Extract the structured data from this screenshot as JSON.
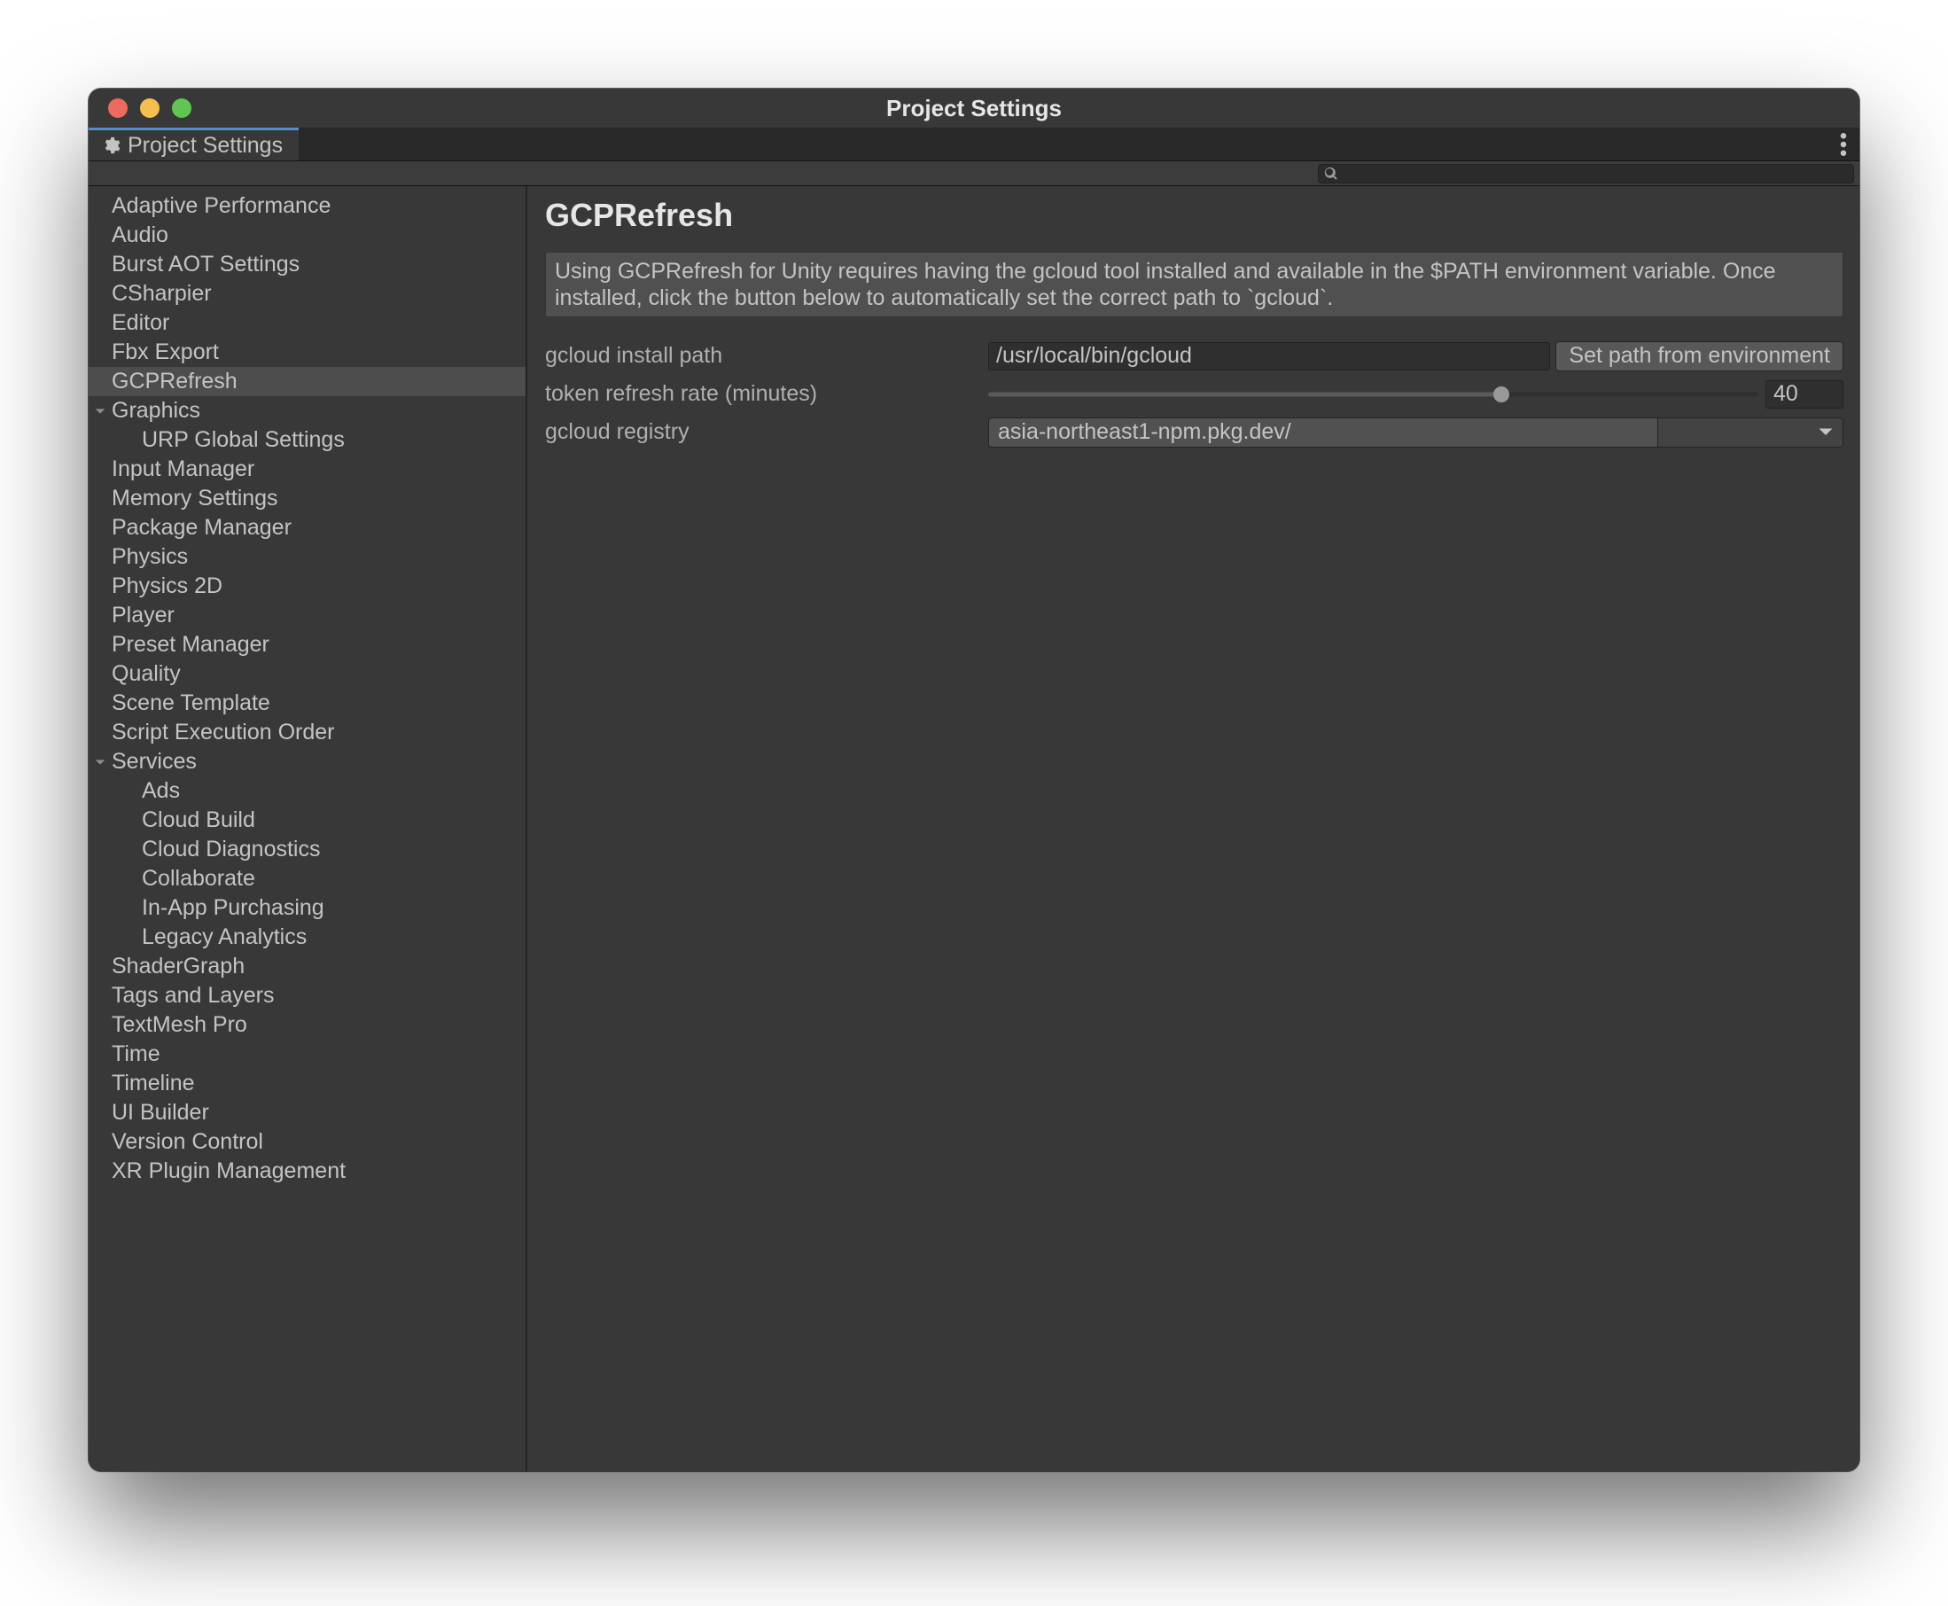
{
  "window": {
    "title": "Project Settings"
  },
  "tab": {
    "label": "Project Settings"
  },
  "search": {
    "value": ""
  },
  "sidebar": {
    "items": [
      {
        "label": "Adaptive Performance",
        "depth": 1
      },
      {
        "label": "Audio",
        "depth": 1
      },
      {
        "label": "Burst AOT Settings",
        "depth": 1
      },
      {
        "label": "CSharpier",
        "depth": 1
      },
      {
        "label": "Editor",
        "depth": 1
      },
      {
        "label": "Fbx Export",
        "depth": 1
      },
      {
        "label": "GCPRefresh",
        "depth": 1,
        "selected": true
      },
      {
        "label": "Graphics",
        "depth": 1,
        "expandable": true,
        "expanded": true
      },
      {
        "label": "URP Global Settings",
        "depth": 2
      },
      {
        "label": "Input Manager",
        "depth": 1
      },
      {
        "label": "Memory Settings",
        "depth": 1
      },
      {
        "label": "Package Manager",
        "depth": 1
      },
      {
        "label": "Physics",
        "depth": 1
      },
      {
        "label": "Physics 2D",
        "depth": 1
      },
      {
        "label": "Player",
        "depth": 1
      },
      {
        "label": "Preset Manager",
        "depth": 1
      },
      {
        "label": "Quality",
        "depth": 1
      },
      {
        "label": "Scene Template",
        "depth": 1
      },
      {
        "label": "Script Execution Order",
        "depth": 1
      },
      {
        "label": "Services",
        "depth": 1,
        "expandable": true,
        "expanded": true
      },
      {
        "label": "Ads",
        "depth": 2
      },
      {
        "label": "Cloud Build",
        "depth": 2
      },
      {
        "label": "Cloud Diagnostics",
        "depth": 2
      },
      {
        "label": "Collaborate",
        "depth": 2
      },
      {
        "label": "In-App Purchasing",
        "depth": 2
      },
      {
        "label": "Legacy Analytics",
        "depth": 2
      },
      {
        "label": "ShaderGraph",
        "depth": 1
      },
      {
        "label": "Tags and Layers",
        "depth": 1
      },
      {
        "label": "TextMesh Pro",
        "depth": 1
      },
      {
        "label": "Time",
        "depth": 1
      },
      {
        "label": "Timeline",
        "depth": 1
      },
      {
        "label": "UI Builder",
        "depth": 1
      },
      {
        "label": "Version Control",
        "depth": 1
      },
      {
        "label": "XR Plugin Management",
        "depth": 1
      }
    ]
  },
  "content": {
    "heading": "GCPRefresh",
    "description": "Using GCPRefresh for Unity requires having the gcloud tool installed and available in the $PATH environment variable. Once installed, click the button below to automatically set the correct path to `gcloud`.",
    "fields": {
      "install_path": {
        "label": "gcloud install path",
        "value": "/usr/local/bin/gcloud",
        "button": "Set path from environment"
      },
      "refresh_rate": {
        "label": "token refresh rate (minutes)",
        "value": 40,
        "min": 0,
        "max": 60
      },
      "registry": {
        "label": "gcloud registry",
        "value": "asia-northeast1-npm.pkg.dev/"
      }
    }
  }
}
